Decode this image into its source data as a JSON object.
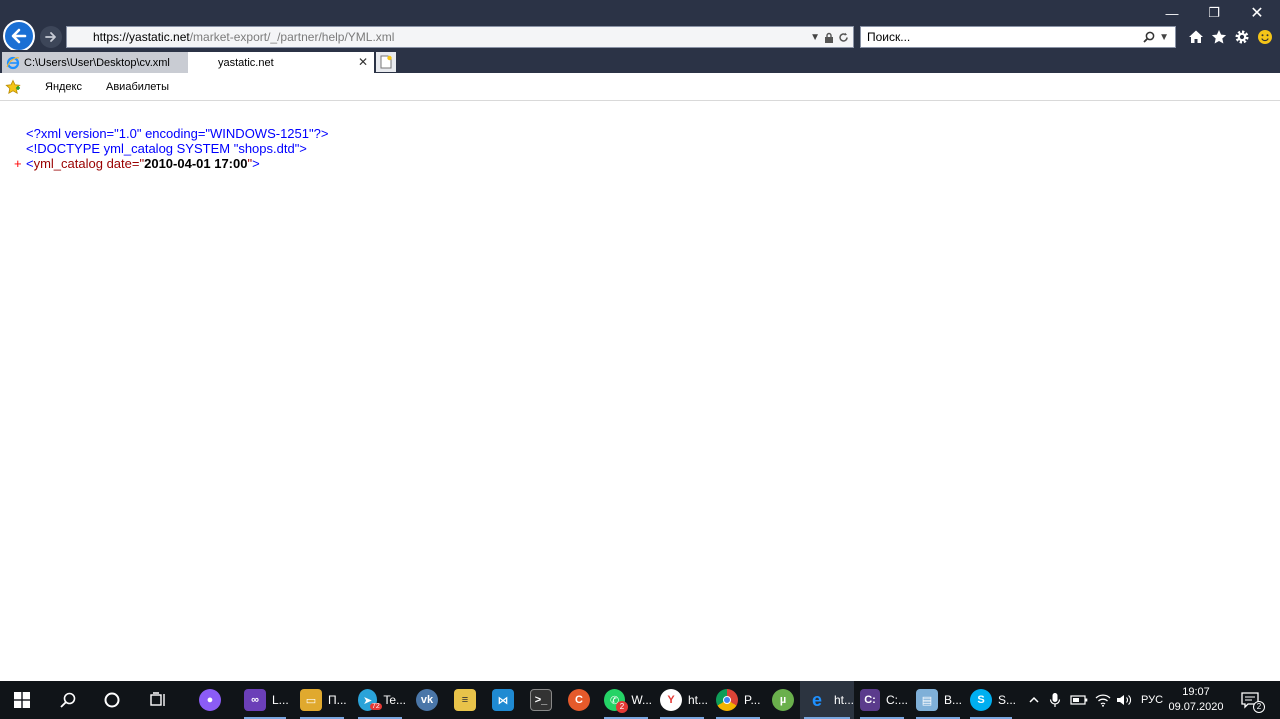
{
  "browser": {
    "address": {
      "domain": "https://yastatic.net",
      "path": "/market-export/_/partner/help/YML.xml"
    },
    "search_placeholder": "Поиск...",
    "tabs": [
      {
        "label": "C:\\Users\\User\\Desktop\\cv.xml",
        "active": false
      },
      {
        "label": "yastatic.net",
        "active": true
      }
    ],
    "favorites": [
      "Яндекс",
      "Авиабилеты"
    ]
  },
  "content": {
    "lines": [
      {
        "text": "<?xml version=\"1.0\" encoding=\"WINDOWS-1251\"?>"
      },
      {
        "text": "<!DOCTYPE yml_catalog SYSTEM \"shops.dtd\">"
      },
      {
        "prefix": "+",
        "open": "<",
        "tag": "yml_catalog",
        "attr": " date=",
        "q1": "\"",
        "value": "2010-04-01 17:00",
        "q2": "\"",
        "close": ">"
      }
    ]
  },
  "taskbar": {
    "apps": [
      {
        "label": "L...",
        "color": "#6b3fb8"
      },
      {
        "label": "П...",
        "color": "#e0a92e"
      },
      {
        "label": "Te...",
        "color": "#2aa3d9",
        "badge": "72"
      },
      {
        "label": "",
        "color": "#4a76a8"
      },
      {
        "label": "",
        "color": "#e8c34a"
      },
      {
        "label": "",
        "color": "#1f8ad2"
      },
      {
        "label": "",
        "color": "#333"
      },
      {
        "label": "",
        "color": "#e55a2b"
      },
      {
        "label": "W...",
        "color": "#25d366",
        "badge": "2"
      },
      {
        "label": "ht...",
        "color": "#fff"
      },
      {
        "label": "P...",
        "color": "#db4437"
      },
      {
        "label": "",
        "color": "#6ab04c"
      },
      {
        "label": "ht...",
        "color": "#1e90ff"
      },
      {
        "label": "C:...",
        "color": "#5b3b8c"
      },
      {
        "label": "B...",
        "color": "#7fb0d8"
      },
      {
        "label": "S...",
        "color": "#00aff0"
      }
    ],
    "language": "РУС",
    "time": "19:07",
    "date": "09.07.2020",
    "notifications": "2"
  },
  "colors": {
    "chrome": "#2b3346",
    "xml_blue": "#0000ff",
    "xml_tag": "#990000"
  }
}
